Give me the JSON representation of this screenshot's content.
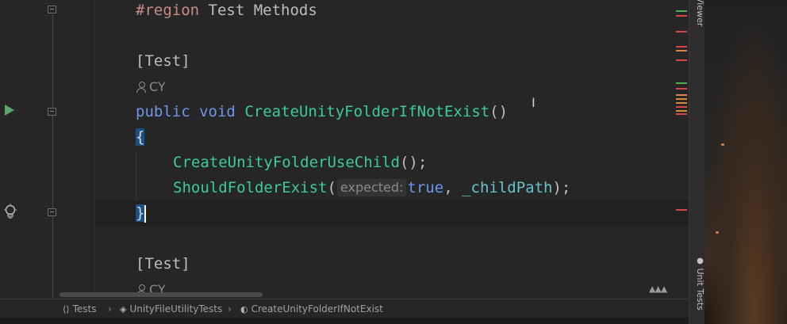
{
  "editor": {
    "region_keyword": "#region",
    "region_name": " Test Methods",
    "attr1": "[Test]",
    "lens1_author": "CY",
    "sig_public": "public",
    "sig_void": "void",
    "sig_method": "CreateUnityFolderIfNotExist",
    "sig_parens": "()",
    "open_brace": "{",
    "call1_method": "CreateUnityFolderUseChild",
    "call1_rest": "();",
    "call2_method": "ShouldFolderExist",
    "call2_open": "(",
    "call2_hint": "expected:",
    "call2_true": "true",
    "call2_comma": ", ",
    "call2_field": "_childPath",
    "call2_close": ");",
    "close_brace": "}",
    "attr2": "[Test]",
    "lens2_author": "CY"
  },
  "right_tabs": {
    "top": "Viewer",
    "bottom": "Unit Tests"
  },
  "breadcrumb": {
    "items": [
      "Tests",
      "UnityFileUtilityTests",
      "CreateUnityFolderIfNotExist"
    ]
  },
  "icons": {
    "run": "run-test-icon",
    "bulb": "lightbulb-icon",
    "reader": "reader-mode-icon",
    "user": "user-icon"
  },
  "colors": {
    "keyword": "#6c95eb",
    "method": "#39cc9b",
    "field": "#66c3cc",
    "region": "#c98c84",
    "run_icon": "#59a869"
  }
}
